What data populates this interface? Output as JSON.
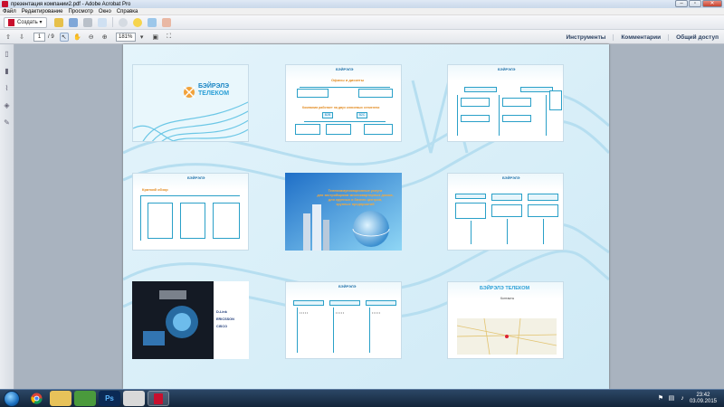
{
  "window": {
    "title": "презентация компании2.pdf - Adobe Acrobat Pro",
    "btn_min": "–",
    "btn_max": "▫",
    "btn_close": "✕"
  },
  "menu": [
    "Файл",
    "Редактирование",
    "Просмотр",
    "Окно",
    "Справка"
  ],
  "toolbar": {
    "create_label": "Создать",
    "create_arrow": "▾"
  },
  "nav": {
    "current_page": "1",
    "page_count": "/ 9",
    "zoom": "181%"
  },
  "right_links": [
    "Инструменты",
    "Комментарии",
    "Общий доступ"
  ],
  "slides": {
    "s1": {
      "logo_line1": "БЭЙРЭЛЭ",
      "logo_line2": "ТЕЛЕКОМ"
    },
    "s2": {
      "title": "Офисы и дискеты",
      "mid": "Компания работает на двух ключевых сегментах",
      "b2b": "B2B",
      "b2c": "B2C"
    },
    "s4": {
      "title": "Краткий обзор"
    },
    "s5": {
      "line1": "Телекоммуникационные услуги",
      "line2": "для застройщиков многоквартирных домов,",
      "line3": "для крупных и бизнес центров,",
      "line4": "крупных предприятий"
    },
    "s7": {
      "brands": [
        "D-Link",
        "ERICSSON",
        "CISCO"
      ]
    },
    "s9": {
      "title": "Контакты"
    }
  },
  "clock": {
    "time": "23:42",
    "date": "03.09.2015"
  },
  "taskbar": {
    "ps": "Ps"
  }
}
